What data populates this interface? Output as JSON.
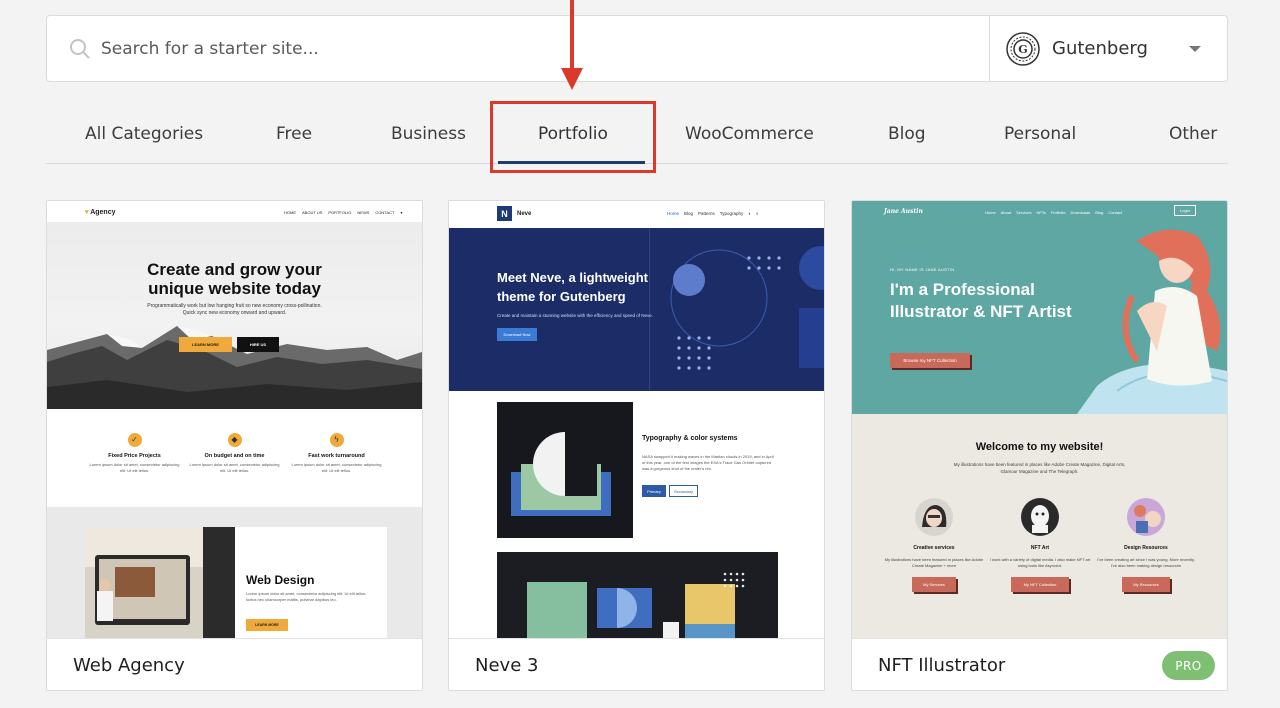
{
  "search": {
    "placeholder": "Search for a starter site...",
    "builder": "Gutenberg"
  },
  "tabs": [
    "All Categories",
    "Free",
    "Business",
    "Portfolio",
    "WooCommerce",
    "Blog",
    "Personal",
    "Other"
  ],
  "active_tab": "Portfolio",
  "cards": [
    {
      "name": "Web Agency",
      "preview": {
        "brand": "Agency",
        "nav": [
          "HOME",
          "ABOUT US",
          "PORTFOLIO",
          "NEWS",
          "CONTACT"
        ],
        "hero_title": "Create and grow your unique website today",
        "hero_text": "Programmatically work but low hanging fruit so new economy cross-pollination. Quick sync new economy onward and upward.",
        "btn1": "LEARN MORE",
        "btn2": "HIRE US",
        "features": [
          {
            "title": "Fixed Price Projects",
            "text": "Lorem ipsum dolor sit amet, consectetur adipiscing elit. Ut elit tellus."
          },
          {
            "title": "On budget and on time",
            "text": "Lorem ipsum dolor sit amet, consectetur adipiscing elit. Ut elit tellus."
          },
          {
            "title": "Fast work turnaround",
            "text": "Lorem ipsum dolor sit amet, consectetur adipiscing elit. Ut elit tellus."
          }
        ],
        "section_title": "Web Design",
        "section_text": "Lorem ipsum dolor sit amet, consectetur adipiscing elit. Ut elit tellus, luctus nec ullamcorper mattis, pulvinar dapibus leo.",
        "section_btn": "LEARN MORE"
      }
    },
    {
      "name": "Neve 3",
      "preview": {
        "brand": "Neve",
        "nav": [
          "Home",
          "Blog",
          "Patterns",
          "Typography"
        ],
        "hero_title": "Meet Neve, a lightweight theme for Gutenberg",
        "hero_text": "Create and maintain a stunning website with the efficiency and speed of Neve.",
        "hero_btn": "Download Now",
        "section_title": "Typography & color systems",
        "section_text": "NASA swapped it making waves in the Martian clouds in 2019, and in April of this year, one of the first images the ESA's Trace Gas Orbiter captured was a gorgeous shot of the crater's rim.",
        "btn1": "Primary",
        "btn2": "Secondary"
      }
    },
    {
      "name": "NFT Illustrator",
      "badge": "PRO",
      "preview": {
        "brand": "Jane Austin",
        "nav": [
          "Home",
          "About",
          "Services",
          "NFTs",
          "Portfolio",
          "Downloads",
          "Blog",
          "Contact"
        ],
        "login": "Login",
        "eyebrow": "HI, MY NAME IS JANE AUSTIN",
        "hero_title": "I'm a Professional Illustrator & NFT Artist",
        "hero_btn": "Browse my NFT Collection",
        "welcome_title": "Welcome to my website!",
        "welcome_text": "My illustrations have been featured in places like Adobe Create Magazine, Digital Arts, Glamour Magazine and The Telegraph.",
        "cols": [
          {
            "title": "Creative services",
            "text": "My illustrations have been featured in places like Adobe Create Magazine + more",
            "btn": "My Services"
          },
          {
            "title": "NFT Art",
            "text": "I work with a variety of digital media. I also make NFT art using tools like AsyncArt.",
            "btn": "My NFT Collection"
          },
          {
            "title": "Design Resources",
            "text": "I've been creating art since I was young. More recently, I've also been making design resources",
            "btn": "My Resources"
          }
        ]
      }
    }
  ],
  "colors": {
    "accent": "#1e3d6b",
    "annotation": "#d93a2b",
    "pro": "#7fbf73",
    "nft_teal": "#5fa7a2",
    "nft_button": "#c8695a",
    "agency_orange": "#f0a93b",
    "neve_blue": "#1f3a78"
  }
}
